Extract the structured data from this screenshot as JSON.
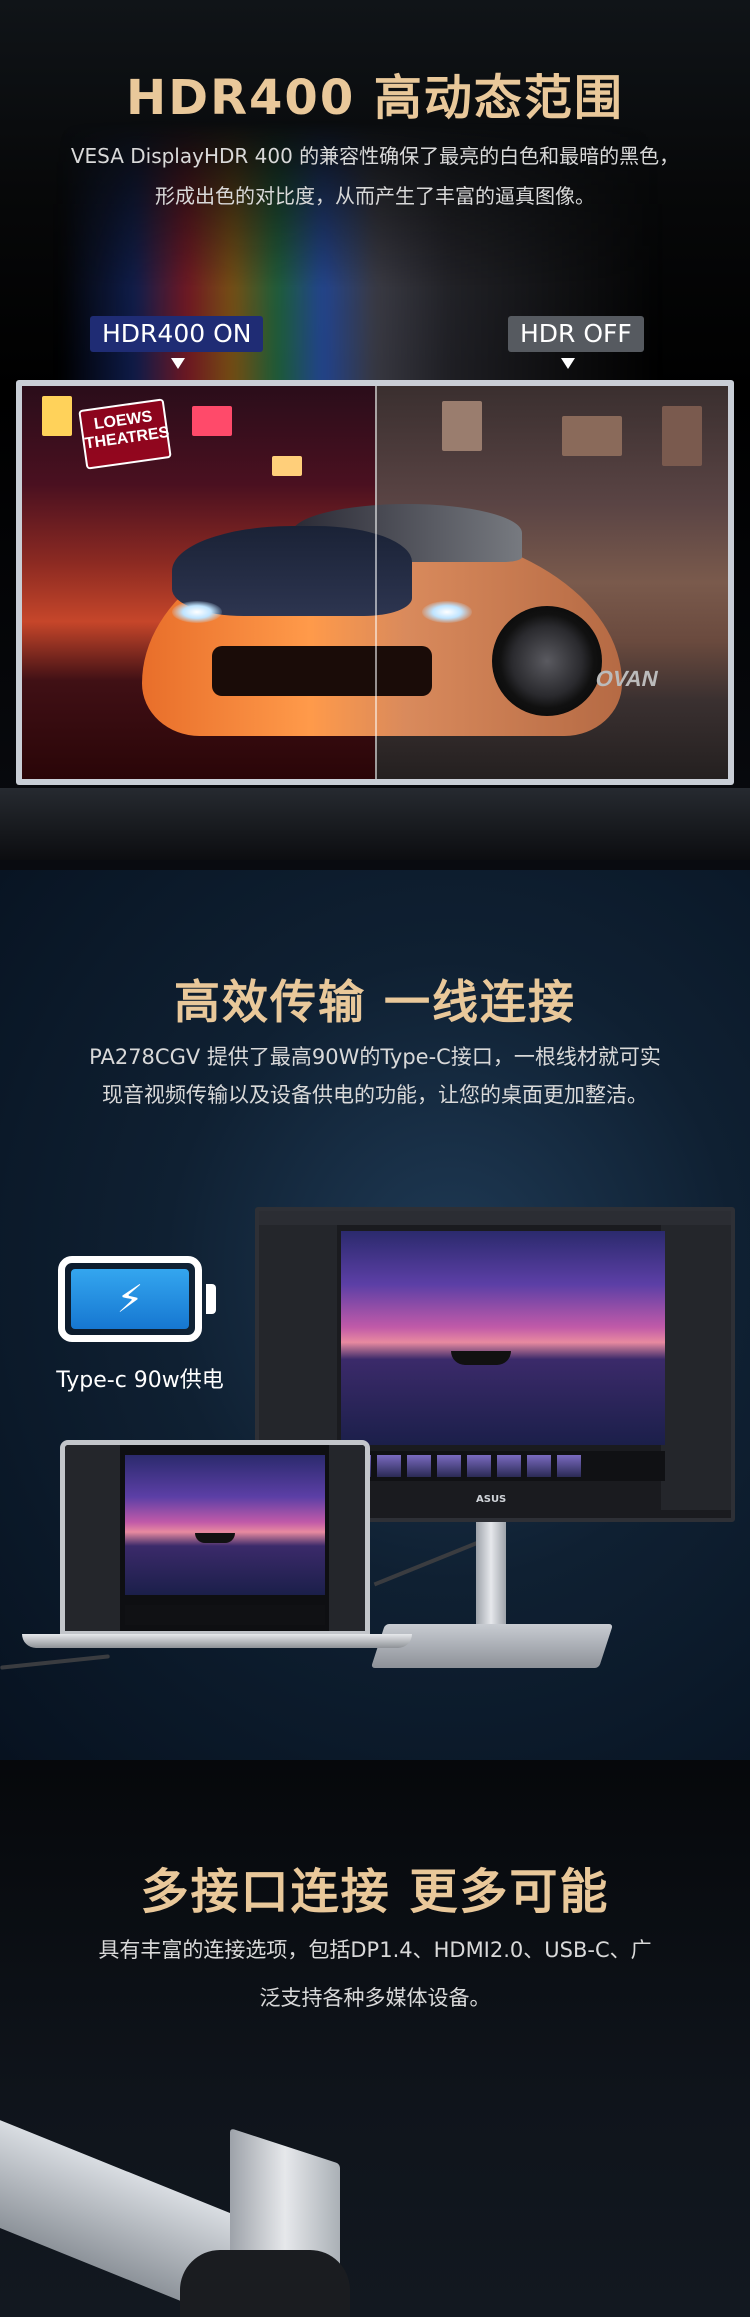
{
  "hdr_section": {
    "title": "HDR400 高动态范围",
    "description_lines": [
      "VESA DisplayHDR 400 的兼容性确保了最亮的白色和最暗的黑色，",
      "形成出色的对比度，从而产生了丰富的逼真图像。"
    ],
    "label_on": "HDR400 ON",
    "label_off": "HDR OFF",
    "colors": {
      "title_gold": "#e9c89a",
      "label_on_bg": "#1f2c74",
      "label_off_bg": "#565a60"
    }
  },
  "typec_section": {
    "title": "高效传输 一线连接",
    "description_lines": [
      "PA278CGV 提供了最高90W的Type-C接口，一根线材就可实",
      "现音视频传输以及设备供电的功能，让您的桌面更加整洁。"
    ],
    "battery_label": "Type-c 90w供电",
    "battery_icon": "battery-charging-icon",
    "monitor_logo": "ASUS",
    "colors": {
      "battery_fill": "#2a8fe0"
    }
  },
  "ports_section": {
    "title": "多接口连接 更多可能",
    "description_lines": [
      "具有丰富的连接选项，包括DP1.4、HDMI2.0、USB-C、广",
      "泛支持各种多媒体设备。"
    ]
  }
}
